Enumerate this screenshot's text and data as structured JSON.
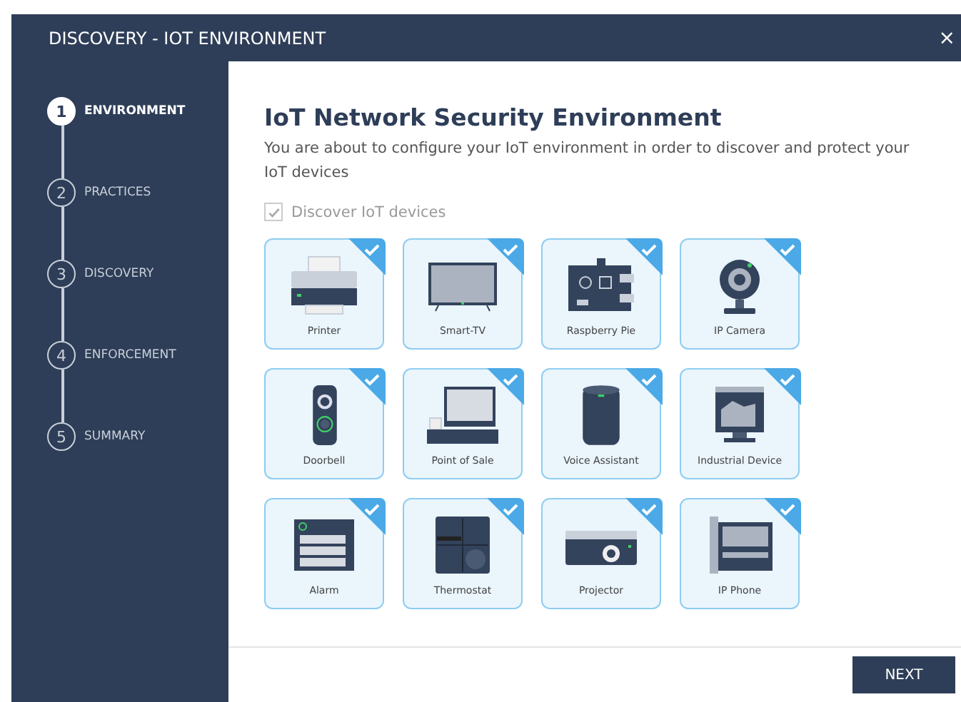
{
  "window": {
    "title": "DISCOVERY - IOT ENVIRONMENT",
    "close": "×"
  },
  "steps": [
    {
      "number": "1",
      "label": "ENVIRONMENT",
      "selected": true
    },
    {
      "number": "2",
      "label": "PRACTICES",
      "selected": false
    },
    {
      "number": "3",
      "label": "DISCOVERY",
      "selected": false
    },
    {
      "number": "4",
      "label": "ENFORCEMENT",
      "selected": false
    },
    {
      "number": "5",
      "label": "SUMMARY",
      "selected": false
    }
  ],
  "heading": "IoT Network Security Environment",
  "description": "You are about to configure your IoT environment in order to discover and protect your IoT devices",
  "discover_checkbox": {
    "label": "Discover IoT devices",
    "checked": true,
    "disabled": true
  },
  "devices": [
    {
      "label": "Printer",
      "kind": "printer",
      "checked": true
    },
    {
      "label": "Smart-TV",
      "kind": "tv",
      "checked": true
    },
    {
      "label": "Raspberry Pie",
      "kind": "board",
      "checked": true
    },
    {
      "label": "IP Camera",
      "kind": "camera",
      "checked": true
    },
    {
      "label": "Doorbell",
      "kind": "doorbell",
      "checked": true
    },
    {
      "label": "Point of Sale",
      "kind": "pos",
      "checked": true
    },
    {
      "label": "Voice Assistant",
      "kind": "speaker",
      "checked": true
    },
    {
      "label": "Industrial Device",
      "kind": "industrial",
      "checked": true
    },
    {
      "label": "Alarm",
      "kind": "alarm",
      "checked": true
    },
    {
      "label": "Thermostat",
      "kind": "thermostat",
      "checked": true
    },
    {
      "label": "Projector",
      "kind": "projector",
      "checked": true
    },
    {
      "label": "IP Phone",
      "kind": "phone",
      "checked": true
    }
  ],
  "next_button": "NEXT"
}
